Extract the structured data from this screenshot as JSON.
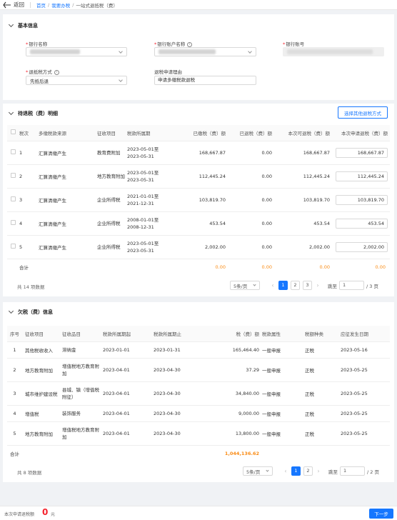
{
  "header": {
    "back_label": "返回",
    "breadcrumb": [
      "首页",
      "我要办税",
      "一站式退抵税（费）"
    ]
  },
  "basic_info": {
    "title": "基本信息",
    "bank_name_label": "银行名称",
    "bank_account_name_label": "银行账户名称",
    "bank_account_number_label": "银行账号",
    "refund_method_label": "退抵税方式",
    "refund_method_value": "先抵后退",
    "refund_reason_label": "退税申请理由",
    "refund_reason_value": "申请多缴税款退税"
  },
  "pending": {
    "title": "待退税（费）明细",
    "other_method_button": "选择其他退税方式",
    "columns": [
      "税次",
      "多缴税款来源",
      "征收项目",
      "税款所属期",
      "已缴税（费）额",
      "已退税（费）额",
      "本次可退税（费）额",
      "本次申请退税（费）额"
    ],
    "rows": [
      {
        "no": "1",
        "source": "汇算清缴产生",
        "item": "教育费附加",
        "period_start": "2023-05-01至",
        "period_end": "2023-05-31",
        "paid": "168,667.87",
        "refunded": "0.00",
        "refundable": "168,667.87",
        "apply": "168,667.87"
      },
      {
        "no": "2",
        "source": "汇算清缴产生",
        "item": "地方教育附加",
        "period_start": "2023-05-01至",
        "period_end": "2023-05-31",
        "paid": "112,445.24",
        "refunded": "0.00",
        "refundable": "112,445.24",
        "apply": "112,445.24"
      },
      {
        "no": "3",
        "source": "汇算清缴产生",
        "item": "企业所得税",
        "period_start": "2021-01-01至",
        "period_end": "2021-12-31",
        "paid": "103,819.70",
        "refunded": "0.00",
        "refundable": "103,819.70",
        "apply": "103,819.70"
      },
      {
        "no": "4",
        "source": "汇算清缴产生",
        "item": "企业所得税",
        "period_start": "2008-01-01至",
        "period_end": "2008-12-31",
        "paid": "453.54",
        "refunded": "0.00",
        "refundable": "453.54",
        "apply": "453.54"
      },
      {
        "no": "5",
        "source": "汇算清缴产生",
        "item": "企业所得税",
        "period_start": "2023-05-01至",
        "period_end": "2023-05-31",
        "paid": "2,002.00",
        "refunded": "0.00",
        "refundable": "2,002.00",
        "apply": "2,002.00"
      }
    ],
    "total_label": "合计",
    "totals": [
      "0.00",
      "0.00",
      "0.00",
      "0.00"
    ],
    "count_text": "共 14 项数据",
    "page_size": "5条/页",
    "pages": [
      "1",
      "2",
      "3"
    ],
    "jump_label": "跳至",
    "jump_value": "1",
    "page_total": "/ 3 页"
  },
  "arrears": {
    "title": "欠税（费）信息",
    "columns": [
      "序号",
      "征收项目",
      "征收品目",
      "税款所属期起",
      "税款所属期止",
      "税（费）额",
      "税款属性",
      "税额种类",
      "应征发生日期"
    ],
    "rows": [
      {
        "no": "1",
        "item": "其他税收收入",
        "sub": "滞纳金",
        "start": "2023-01-01",
        "end": "2023-01-31",
        "amount": "165,464.40",
        "attr": "一般申报",
        "kind": "正税",
        "date": "2023-05-16"
      },
      {
        "no": "2",
        "item": "地方教育附加",
        "sub": "增值税地方教育附加",
        "start": "2023-04-01",
        "end": "2023-04-30",
        "amount": "37.29",
        "attr": "一般申报",
        "kind": "正税",
        "date": "2023-05-25"
      },
      {
        "no": "3",
        "item": "城市维护建设税",
        "sub": "县城、镇（增值税附征）",
        "start": "2023-04-01",
        "end": "2023-04-30",
        "amount": "34,840.00",
        "attr": "一般申报",
        "kind": "正税",
        "date": "2023-05-25"
      },
      {
        "no": "4",
        "item": "增值税",
        "sub": "装饰服务",
        "start": "2023-04-01",
        "end": "2023-04-30",
        "amount": "9,000.00",
        "attr": "一般申报",
        "kind": "正税",
        "date": "2023-05-25"
      },
      {
        "no": "5",
        "item": "地方教育附加",
        "sub": "增值税地方教育附加",
        "start": "2023-04-01",
        "end": "2023-04-30",
        "amount": "13,800.00",
        "attr": "一般申报",
        "kind": "正税",
        "date": "2023-05-25"
      }
    ],
    "total_label": "合计",
    "total_amount": "1,044,136.62",
    "count_text": "共 8 项数据",
    "page_size": "5条/页",
    "pages": [
      "1",
      "2"
    ],
    "jump_label": "跳至",
    "jump_value": "1",
    "page_total": "/ 2 页"
  },
  "footer": {
    "amount_label": "本次申请退税额",
    "amount_value": "0",
    "unit": "元",
    "next_button": "下一步"
  },
  "colors": {
    "primary": "#1677ff",
    "total_orange": "#fa8c16",
    "amount_red": "#f5222d"
  }
}
